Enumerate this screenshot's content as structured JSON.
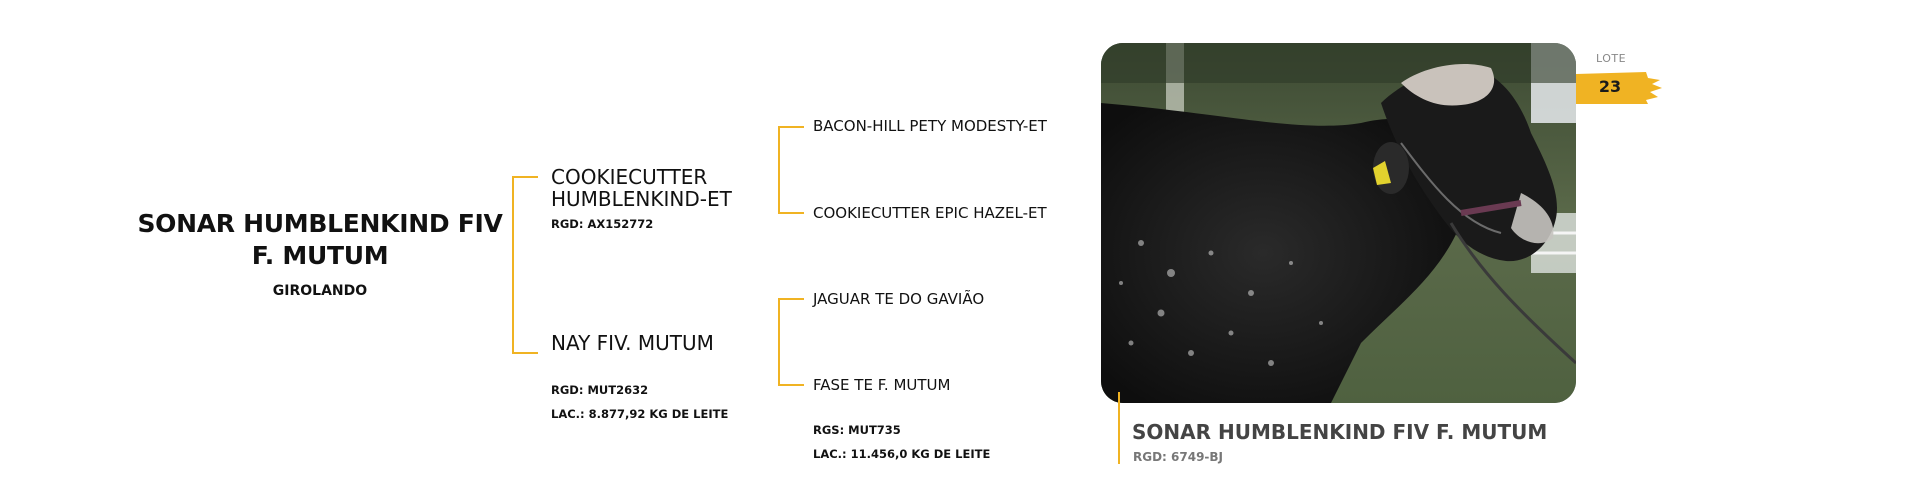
{
  "animal": {
    "name_line1": "SONAR HUMBLENKIND FIV",
    "name_line2": "F. MUTUM",
    "breed": "GIROLANDO"
  },
  "pedigree": {
    "sire": {
      "name_line1": "COOKIECUTTER",
      "name_line2": "HUMBLENKIND-ET",
      "rgd": "RGD: AX152772",
      "sire": "BACON-HILL PETY MODESTY-ET",
      "dam": "COOKIECUTTER EPIC HAZEL-ET"
    },
    "dam": {
      "name": "NAY FIV. MUTUM",
      "rgd": "RGD: MUT2632",
      "lac": "LAC.: 8.877,92 KG DE LEITE",
      "sire": "JAGUAR TE DO GAVIÃO",
      "dam": "FASE TE F. MUTUM",
      "dam_rgs": "RGS: MUT735",
      "dam_lac": "LAC.: 11.456,0 KG DE LEITE"
    }
  },
  "lote": {
    "label": "LOTE",
    "number": "23"
  },
  "caption": {
    "name": "SONAR HUMBLENKIND FIV F. MUTUM",
    "rgd": "RGD: 6749-BJ"
  },
  "colors": {
    "accent": "#f0b323"
  }
}
